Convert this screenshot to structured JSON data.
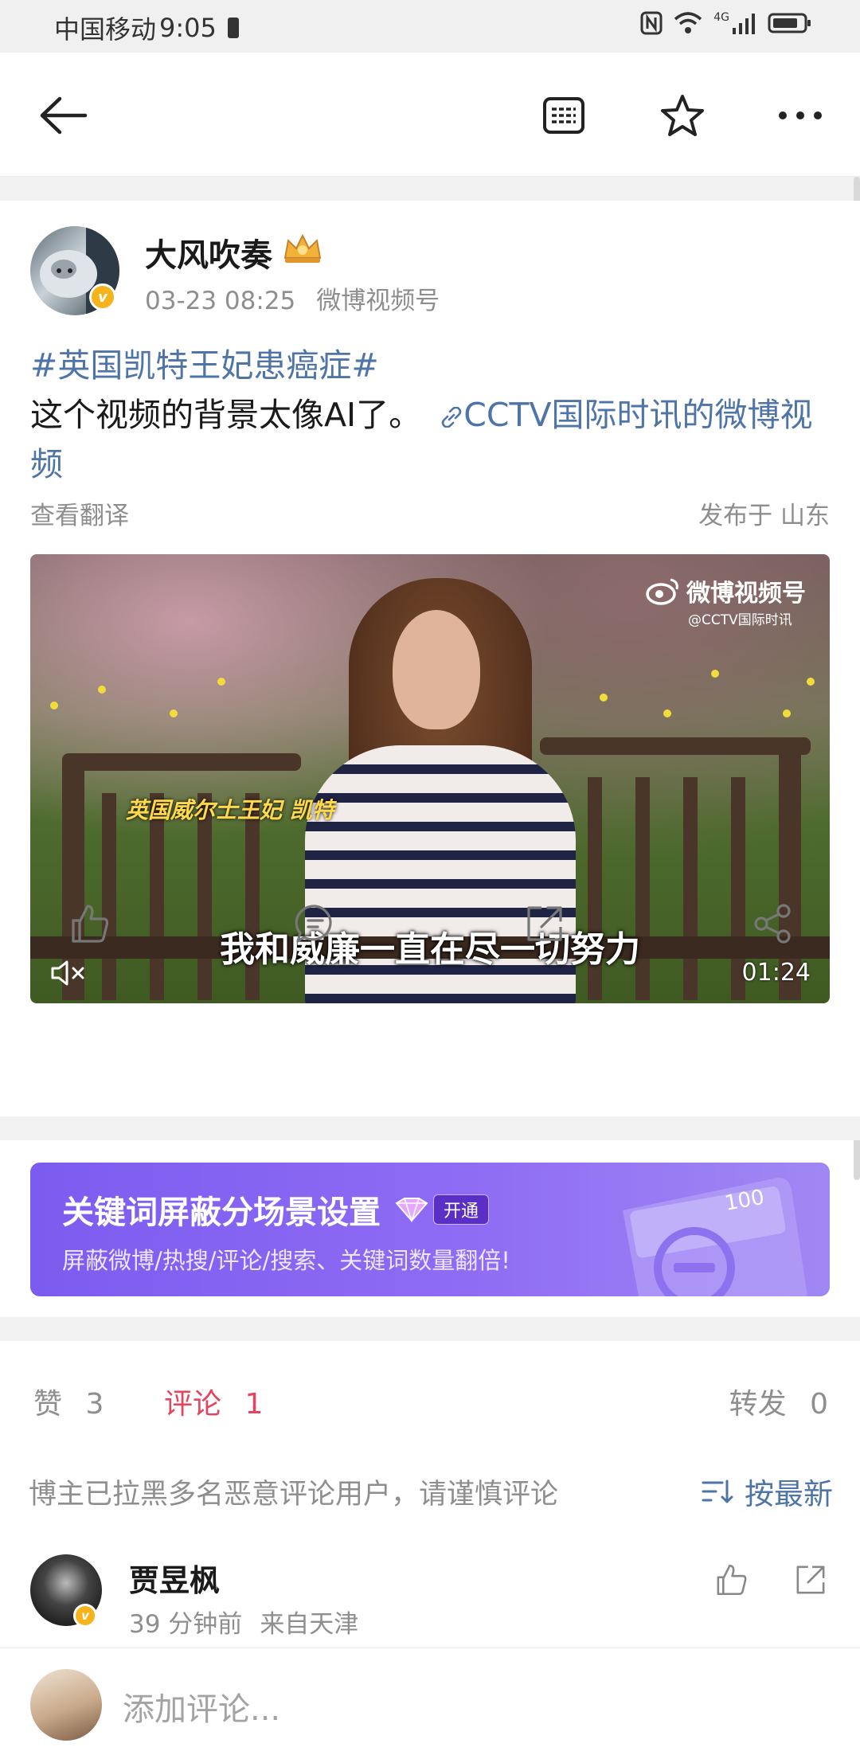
{
  "status_bar": {
    "carrier": "中国移动",
    "time": "9:05",
    "network": "4G"
  },
  "post": {
    "author": "大风吹奏",
    "time": "03-23 08:25",
    "source": "微博视频号",
    "hashtag": "#英国凯特王妃患癌症#",
    "text": "这个视频的背景太像AI了。",
    "link_text": "CCTV国际时讯的微博视频",
    "translate": "查看翻译",
    "location": "发布于 山东",
    "video": {
      "watermark_main": "微博视频号",
      "watermark_sub": "@CCTV国际时讯",
      "name_caption": "英国威尔士王妃 凯特",
      "subtitle": "我和威廉一直在尽一切努力",
      "duration": "01:24"
    }
  },
  "banner": {
    "title": "关键词屏蔽分场景设置",
    "badge": "开通",
    "subtitle": "屏蔽微博/热搜/评论/搜索、关键词数量翻倍!",
    "deco_number": "100"
  },
  "tabs": {
    "likes_label": "赞",
    "likes_count": "3",
    "comments_label": "评论",
    "comments_count": "1",
    "reposts_label": "转发",
    "reposts_count": "0"
  },
  "notice": "博主已拉黑多名恶意评论用户，请谨慎评论",
  "sort_label": "按最新",
  "comments": [
    {
      "name": "贾昱枫",
      "time": "39 分钟前",
      "from": "来自天津"
    }
  ],
  "comment_input": {
    "placeholder": "添加评论..."
  },
  "colors": {
    "link": "#4f74a8",
    "active_tab": "#e3455e",
    "banner": "#7c5cf0"
  }
}
